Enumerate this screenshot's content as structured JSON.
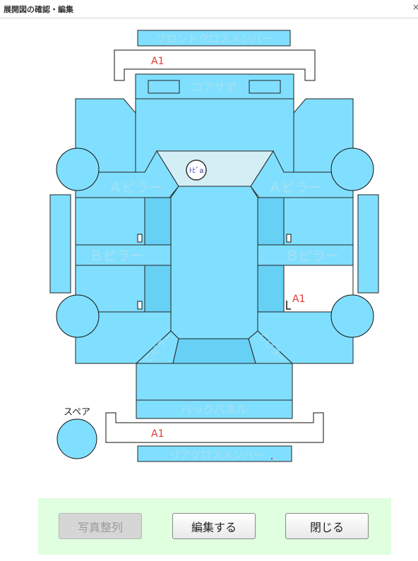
{
  "window": {
    "title": "展開図の確認・編集",
    "close_glyph": "×"
  },
  "diagram": {
    "front_cross_member": "フロントクロスメンバー",
    "core_support": "コアサポ",
    "a_pillar_left": "Ａピラー",
    "a_pillar_right": "Ａピラー",
    "b_pillar_left": "Ｂピラー",
    "b_pillar_right": "Ｂピラー",
    "c_pillar_left": "Ｃピラー",
    "c_pillar_right": "Ｃピラー",
    "back_panel": "バックパネル",
    "rear_cross_member": "リアクロスメンバー",
    "spare_label": "スペア",
    "windshield_badge": "ﾄﾋﾞa",
    "marks": {
      "front_bumper": "A1",
      "right_rear_door": "A1",
      "rear_bumper": "A1"
    }
  },
  "footer": {
    "photo_sort_label": "写真整列",
    "edit_label": "編集する",
    "close_label": "閉じる"
  }
}
